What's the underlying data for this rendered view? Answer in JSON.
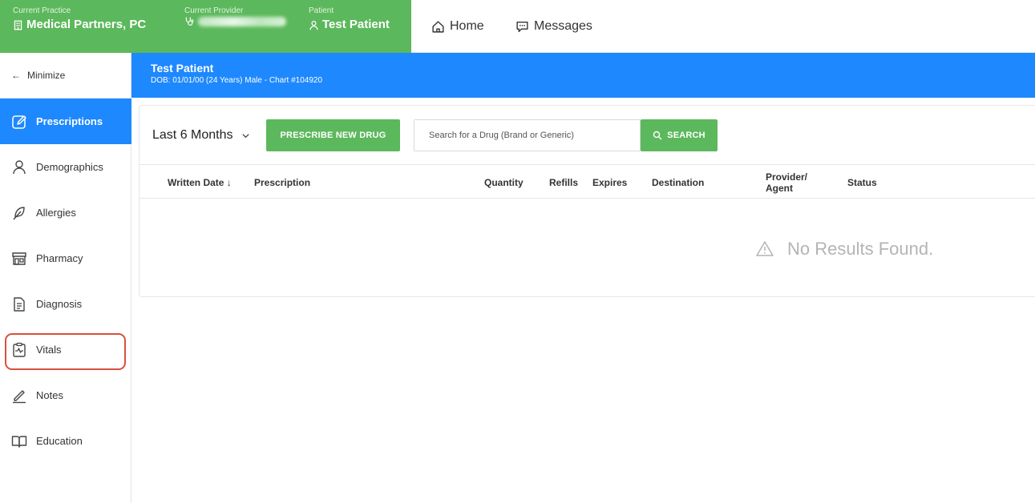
{
  "context_bar": {
    "practice_label": "Current Practice",
    "practice_value": "Medical Partners, PC",
    "provider_label": "Current Provider",
    "patient_label": "Patient",
    "patient_value": "Test Patient",
    "bg_color": "#5cb85c"
  },
  "topnav": {
    "home_label": "Home",
    "messages_label": "Messages"
  },
  "sidebar": {
    "minimize_label": "Minimize",
    "items": [
      {
        "label": "Prescriptions",
        "icon": "pen-square-icon",
        "active": true
      },
      {
        "label": "Demographics",
        "icon": "person-icon"
      },
      {
        "label": "Allergies",
        "icon": "feather-icon"
      },
      {
        "label": "Pharmacy",
        "icon": "storefront-icon"
      },
      {
        "label": "Diagnosis",
        "icon": "document-icon"
      },
      {
        "label": "Vitals",
        "icon": "clipboard-pulse-icon"
      },
      {
        "label": "Notes",
        "icon": "pencil-line-icon"
      },
      {
        "label": "Education",
        "icon": "book-icon"
      }
    ],
    "active_color": "#1e88ff",
    "highlight_color": "#d9503f"
  },
  "patient_header": {
    "name": "Test Patient",
    "info": "DOB: 01/01/00 (24 Years) Male - Chart #104920"
  },
  "toolbar": {
    "range_value": "Last 6 Months",
    "prescribe_label": "PRESCRIBE NEW DRUG",
    "search_placeholder": "Search for a Drug (Brand or Generic)",
    "search_label": "SEARCH"
  },
  "table": {
    "columns": {
      "written_date": "Written Date ↓",
      "prescription": "Prescription",
      "quantity": "Quantity",
      "refills": "Refills",
      "expires": "Expires",
      "destination": "Destination",
      "provider_agent_1": "Provider/",
      "provider_agent_2": "Agent",
      "status": "Status"
    },
    "empty_message": "No Results Found."
  }
}
